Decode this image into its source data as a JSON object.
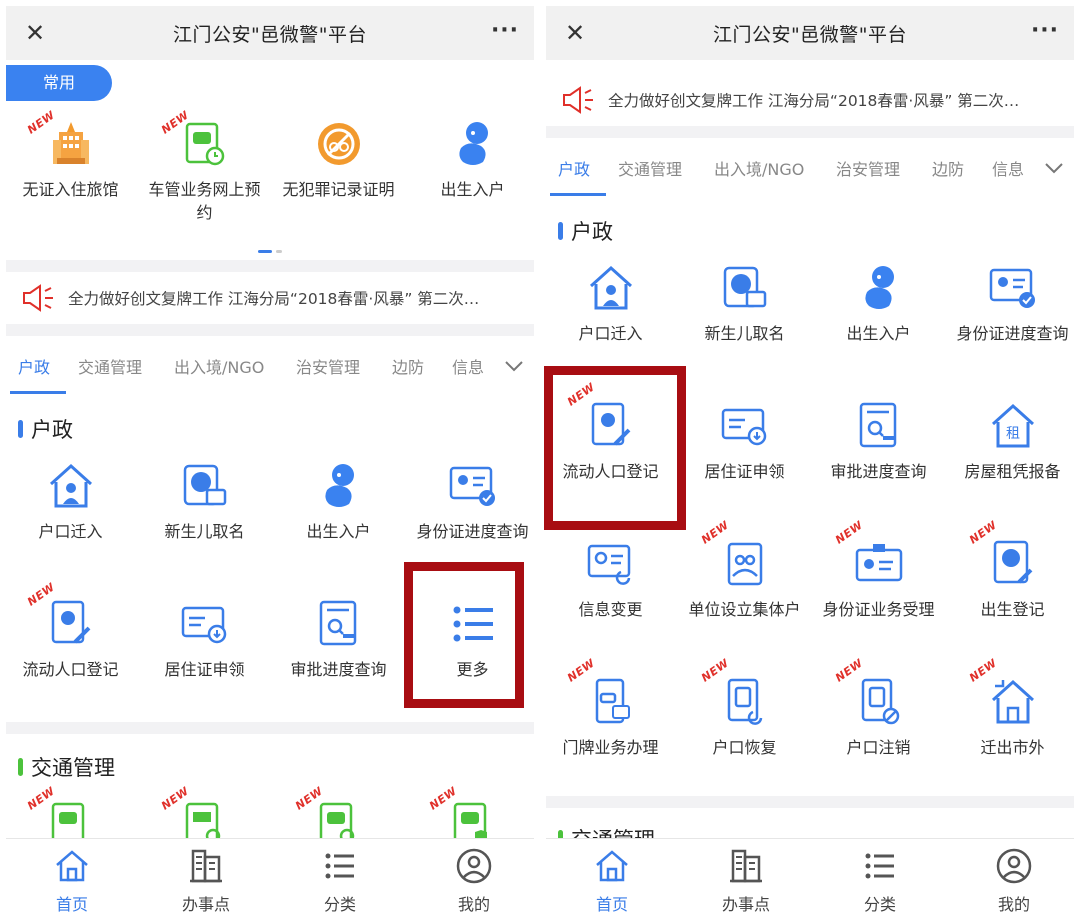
{
  "app_title": "江门公安\"邑微警\"平台",
  "close_glyph": "✕",
  "more_glyph": "···",
  "left": {
    "common_label": "常用",
    "common_items": [
      {
        "label": "无证入住旅馆",
        "icon": "hotel-icon",
        "new": true
      },
      {
        "label": "车管业务网上预约",
        "icon": "car-appointment-icon",
        "new": true
      },
      {
        "label": "无犯罪记录证明",
        "icon": "no-crime-certificate-icon",
        "new": false
      },
      {
        "label": "出生入户",
        "icon": "baby-icon",
        "new": false
      }
    ],
    "notice": "全力做好创文复牌工作 江海分局“2018春雷·风暴” 第二次…",
    "tabs": [
      "户政",
      "交通管理",
      "出入境/NGO",
      "治安管理",
      "边防",
      "信息"
    ],
    "section_hukou": "户政",
    "hukou_items": [
      {
        "label": "户口迁入",
        "icon": "house-move-icon",
        "new": false
      },
      {
        "label": "新生儿取名",
        "icon": "newborn-name-icon",
        "new": false
      },
      {
        "label": "出生入户",
        "icon": "baby-icon",
        "new": false
      },
      {
        "label": "身份证进度查询",
        "icon": "id-card-check-icon",
        "new": false
      },
      {
        "label": "流动人口登记",
        "icon": "floating-population-icon",
        "new": true
      },
      {
        "label": "居住证申领",
        "icon": "residence-permit-icon",
        "new": false
      },
      {
        "label": "审批进度查询",
        "icon": "approval-progress-icon",
        "new": false
      },
      {
        "label": "更多",
        "icon": "list-more-icon",
        "new": false
      }
    ],
    "section_traffic": "交通管理",
    "new_badge": "NEW"
  },
  "right": {
    "notice": "全力做好创文复牌工作 江海分局“2018春雷·风暴” 第二次…",
    "tabs": [
      "户政",
      "交通管理",
      "出入境/NGO",
      "治安管理",
      "边防",
      "信息"
    ],
    "section_hukou": "户政",
    "hukou_items": [
      {
        "label": "户口迁入",
        "icon": "house-move-icon",
        "new": false
      },
      {
        "label": "新生儿取名",
        "icon": "newborn-name-icon",
        "new": false
      },
      {
        "label": "出生入户",
        "icon": "baby-icon",
        "new": false
      },
      {
        "label": "身份证进度查询",
        "icon": "id-card-check-icon",
        "new": false
      },
      {
        "label": "流动人口登记",
        "icon": "floating-population-icon",
        "new": true
      },
      {
        "label": "居住证申领",
        "icon": "residence-permit-icon",
        "new": false
      },
      {
        "label": "审批进度查询",
        "icon": "approval-progress-icon",
        "new": false
      },
      {
        "label": "房屋租凭报备",
        "icon": "house-rent-icon",
        "new": false
      },
      {
        "label": "信息变更",
        "icon": "info-change-icon",
        "new": false
      },
      {
        "label": "单位设立集体户",
        "icon": "collective-household-icon",
        "new": true
      },
      {
        "label": "身份证业务受理",
        "icon": "id-card-business-icon",
        "new": true
      },
      {
        "label": "出生登记",
        "icon": "birth-register-icon",
        "new": true
      },
      {
        "label": "门牌业务办理",
        "icon": "doorplate-icon",
        "new": true
      },
      {
        "label": "户口恢复",
        "icon": "household-restore-icon",
        "new": true
      },
      {
        "label": "户口注销",
        "icon": "household-cancel-icon",
        "new": true
      },
      {
        "label": "迁出市外",
        "icon": "move-out-icon",
        "new": true
      }
    ],
    "section_traffic": "交通管理"
  },
  "tabbar": [
    {
      "label": "首页",
      "icon": "home-icon"
    },
    {
      "label": "办事点",
      "icon": "building-icon"
    },
    {
      "label": "分类",
      "icon": "category-list-icon"
    },
    {
      "label": "我的",
      "icon": "user-icon"
    }
  ],
  "colors": {
    "accent": "#3a7de8",
    "orange": "#f29a2e",
    "new_red": "#e0302a",
    "highlight_box": "#a80d12",
    "traffic_green": "#4cc23c"
  }
}
